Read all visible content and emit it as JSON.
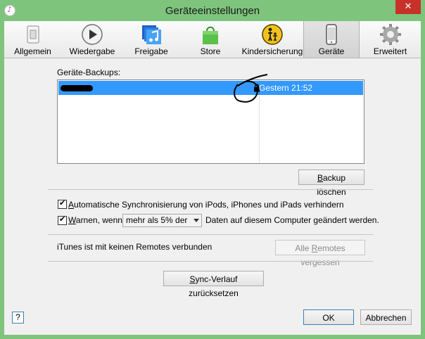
{
  "window": {
    "title": "Geräteeinstellungen",
    "close_glyph": "✕"
  },
  "tabs": [
    {
      "label": "Allgemein",
      "icon": "switch-icon"
    },
    {
      "label": "Wiedergabe",
      "icon": "play-icon"
    },
    {
      "label": "Freigabe",
      "icon": "music-library-icon"
    },
    {
      "label": "Store",
      "icon": "shopping-bag-icon"
    },
    {
      "label": "Kindersicherung",
      "icon": "parental-control-icon"
    },
    {
      "label": "Geräte",
      "icon": "iphone-icon",
      "active": true
    },
    {
      "label": "Erweitert",
      "icon": "gear-icon"
    }
  ],
  "backups": {
    "label": "Geräte-Backups:",
    "rows": [
      {
        "date": "Gestern 21:52",
        "locked": true,
        "selected": true
      }
    ],
    "delete_button": {
      "pre": "",
      "accel": "B",
      "post": "ackup löschen"
    }
  },
  "options": {
    "auto_sync": {
      "checked": true,
      "pre": "",
      "accel": "A",
      "post": "utomatische Synchronisierung von iPods, iPhones und iPads verhindern"
    },
    "warn": {
      "checked": true,
      "pre": "",
      "accel": "W",
      "post": "arnen, wenn",
      "threshold": "mehr als 5% der",
      "suffix": "Daten auf diesem Computer geändert werden."
    }
  },
  "remotes": {
    "status": "iTunes ist mit keinen Remotes verbunden",
    "forget_button": {
      "pre": "Alle ",
      "accel": "R",
      "post": "emotes vergessen",
      "disabled": true
    }
  },
  "sync_reset": {
    "pre": "",
    "accel": "S",
    "post": "ync-Verlauf zurücksetzen"
  },
  "footer": {
    "help": "?",
    "ok": "OK",
    "cancel": "Abbrechen"
  },
  "colors": {
    "titlebar": "#7ec47d",
    "selection": "#3399ff",
    "close": "#c7312a"
  }
}
